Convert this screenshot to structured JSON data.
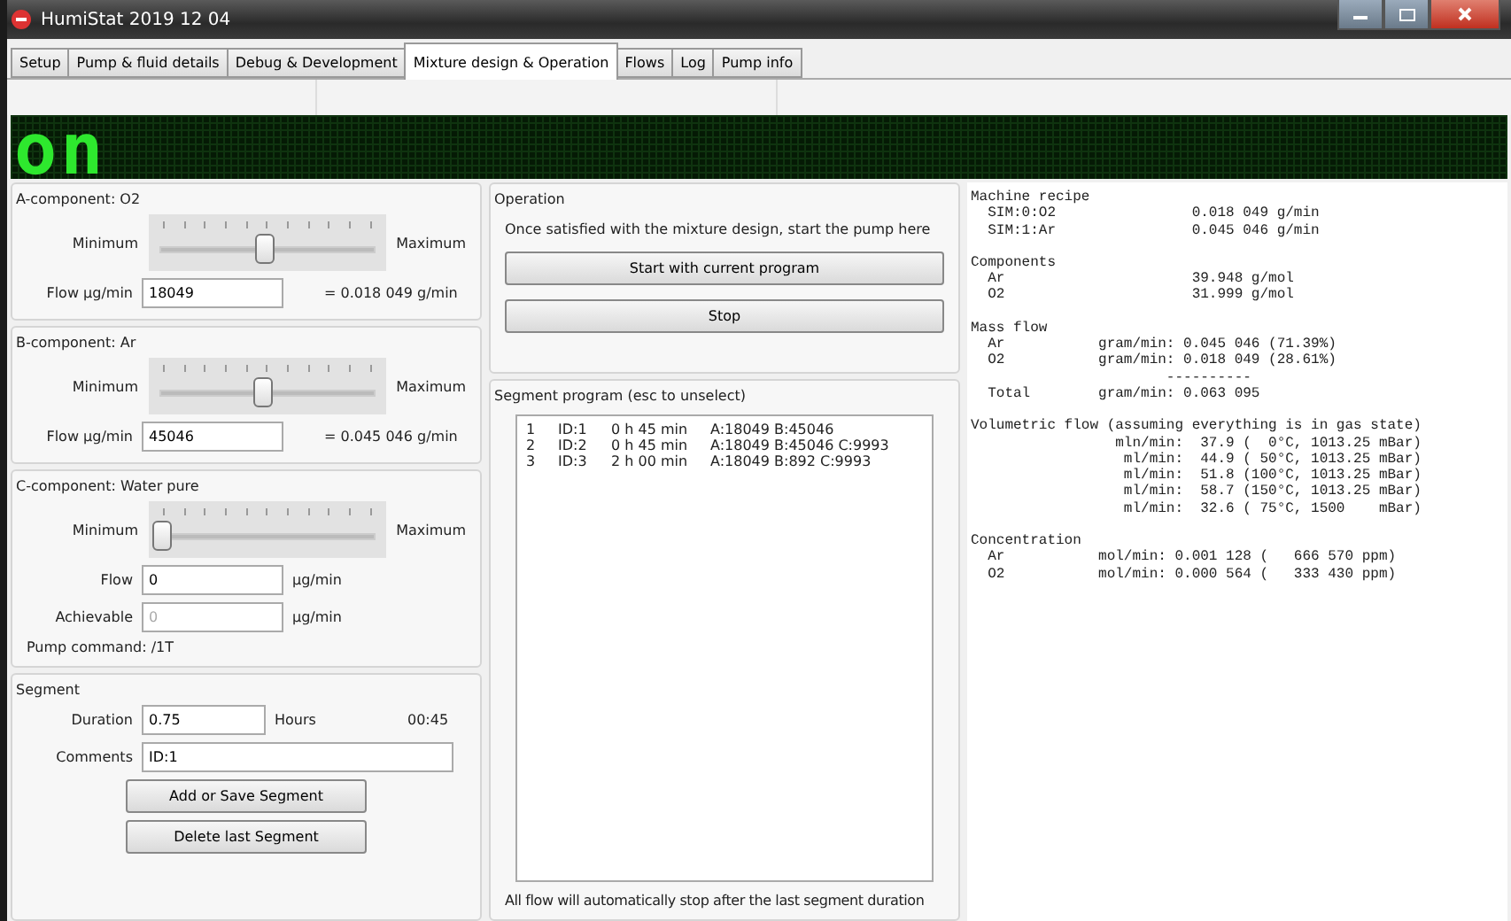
{
  "window": {
    "title": "HumiStat 2019 12 04"
  },
  "tabs": [
    {
      "label": "Setup",
      "selected": false
    },
    {
      "label": "Pump & fluid details",
      "selected": false
    },
    {
      "label": "Debug & Development",
      "selected": false
    },
    {
      "label": "Mixture design & Operation",
      "selected": true
    },
    {
      "label": "Flows",
      "selected": false
    },
    {
      "label": "Log",
      "selected": false
    },
    {
      "label": "Pump info",
      "selected": false
    }
  ],
  "led_display": {
    "text": "on"
  },
  "components": [
    {
      "title": "A-component: O2",
      "kind": "gas",
      "min_label": "Minimum",
      "max_label": "Maximum",
      "level": 0.46,
      "flow_label": "Flow µg/min",
      "flow_value": "18049",
      "result": "= 0.018 049  g/min"
    },
    {
      "title": "B-component: Ar",
      "kind": "gas",
      "min_label": "Minimum",
      "max_label": "Maximum",
      "level": 0.45,
      "flow_label": "Flow µg/min",
      "flow_value": "45046",
      "result": "= 0.045 046  g/min"
    },
    {
      "title": "C-component: Water pure",
      "kind": "liquid",
      "min_label": "Minimum",
      "max_label": "Maximum",
      "level": 0,
      "flow_label": "Flow",
      "flow_value": "0",
      "flow_unit": "µg/min",
      "achievable_label": "Achievable",
      "achievable_value": "0",
      "achievable_disabled": true,
      "achievable_unit": "µg/min",
      "pump_command": "Pump command:  /1T"
    }
  ],
  "segment": {
    "title": "Segment",
    "duration_label": "Duration",
    "duration_value": "0.75",
    "duration_unit": "Hours",
    "duration_time": "00:45",
    "comments_label": "Comments",
    "comments_value": "ID:1",
    "buttons": [
      "Add or Save Segment",
      "Delete last Segment"
    ]
  },
  "operation": {
    "title": "Operation",
    "hint": "Once satisfied with the mixture design, start the pump here",
    "buttons": [
      "Start with current program",
      "Stop"
    ]
  },
  "segment_program": {
    "title": "Segment program (esc to unselect)",
    "rows": [
      {
        "num": "1",
        "id": "ID:1",
        "duration": "0 h 45 min",
        "flows": "A:18049 B:45046"
      },
      {
        "num": "2",
        "id": "ID:2",
        "duration": "0 h 45 min",
        "flows": "A:18049 B:45046 C:9993"
      },
      {
        "num": "3",
        "id": "ID:3",
        "duration": "2 h 00 min",
        "flows": "A:18049 B:892 C:9993"
      }
    ],
    "footer": "All flow will automatically stop after the last segment duration"
  },
  "report": [
    {
      "heading": "Machine recipe",
      "lines": [
        "  SIM:0:O2                0.018 049 g/min",
        "  SIM:1:Ar                0.045 046 g/min"
      ]
    },
    {
      "heading": "Components",
      "lines": [
        "  Ar                      39.948 g/mol",
        "  O2                      31.999 g/mol"
      ]
    },
    {
      "heading": "Mass flow",
      "lines": [
        "  Ar           gram/min: 0.045 046 (71.39%)",
        "  O2           gram/min: 0.018 049 (28.61%)",
        "                       ----------",
        "  Total        gram/min: 0.063 095"
      ]
    },
    {
      "heading": "Volumetric flow (assuming everything is in gas state)",
      "lines": [
        "                 mln/min:  37.9 (  0°C, 1013.25 mBar)",
        "                  ml/min:  44.9 ( 50°C, 1013.25 mBar)",
        "                  ml/min:  51.8 (100°C, 1013.25 mBar)",
        "                  ml/min:  58.7 (150°C, 1013.25 mBar)",
        "                  ml/min:  32.6 ( 75°C, 1500    mBar)"
      ]
    },
    {
      "heading": "Concentration",
      "lines": [
        "  Ar           mol/min: 0.001 128 (   666 570 ppm)",
        "  O2           mol/min: 0.000 564 (   333 430 ppm)"
      ]
    }
  ]
}
